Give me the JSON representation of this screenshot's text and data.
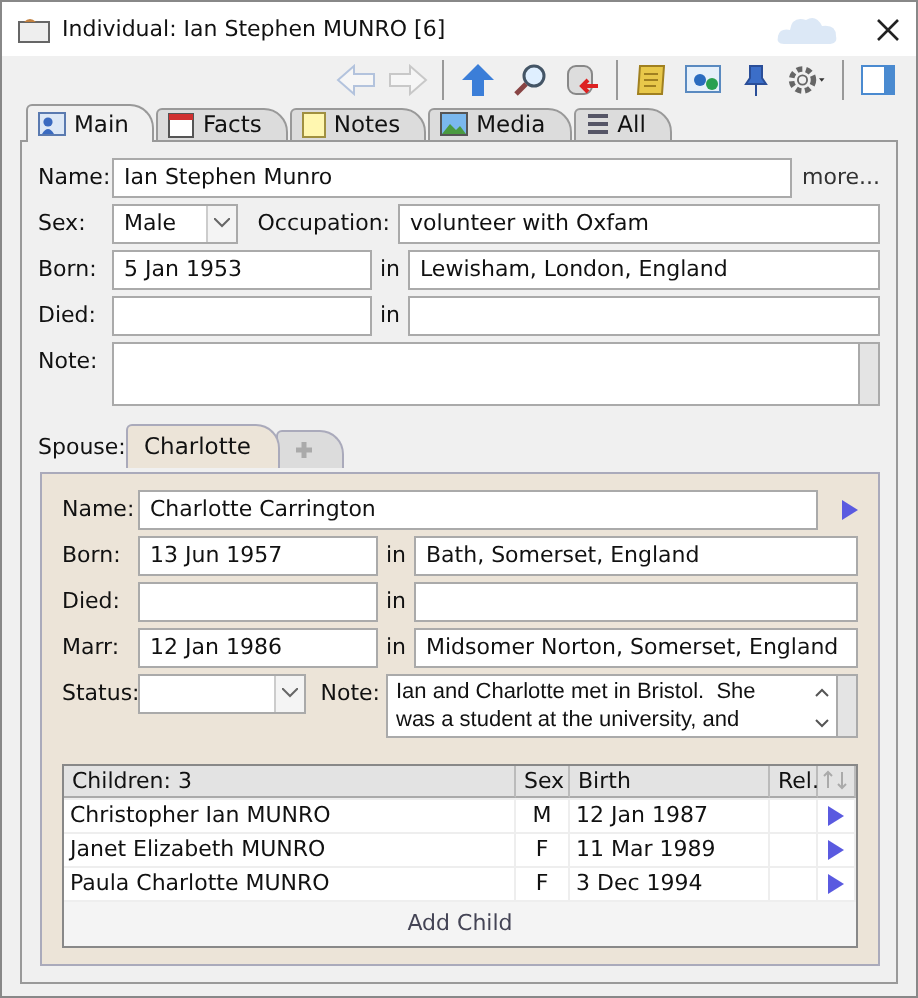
{
  "window": {
    "title": "Individual: Ian Stephen MUNRO [6]"
  },
  "toolbar": [
    {
      "kind": "back",
      "disabled": true
    },
    {
      "kind": "forward",
      "disabled": true
    },
    {
      "kind": "up",
      "disabled": false
    },
    {
      "kind": "search",
      "disabled": false
    },
    {
      "kind": "database",
      "disabled": false
    },
    {
      "kind": "scroll",
      "disabled": false
    },
    {
      "kind": "card",
      "disabled": false
    },
    {
      "kind": "pin",
      "disabled": false
    },
    {
      "kind": "gear",
      "disabled": false
    },
    {
      "kind": "panel",
      "disabled": false
    }
  ],
  "tabs": [
    {
      "label": "Main",
      "kind": "person",
      "selected": true
    },
    {
      "label": "Facts",
      "kind": "calendar",
      "selected": false
    },
    {
      "label": "Notes",
      "kind": "note",
      "selected": false
    },
    {
      "label": "Media",
      "kind": "image",
      "selected": false
    },
    {
      "label": "All",
      "kind": "list",
      "selected": false
    }
  ],
  "person": {
    "name": {
      "label": "Name:",
      "value": "Ian Stephen Munro",
      "more": "more..."
    },
    "sex": {
      "label": "Sex:",
      "value": "Male"
    },
    "occupation": {
      "label": "Occupation:",
      "value": "volunteer with Oxfam"
    },
    "born": {
      "label": "Born:",
      "value": "5 Jan 1953",
      "place_label": "in",
      "place": "Lewisham, London, England"
    },
    "died": {
      "label": "Died:",
      "place_label": "in"
    },
    "note": {
      "label": "Note:"
    }
  },
  "spouse": {
    "label": "Spouse:",
    "tabs": [
      {
        "kind": "name",
        "label": "Charlotte",
        "selected": true
      },
      {
        "kind": "add",
        "selected": false
      }
    ],
    "name": {
      "label": "Name:",
      "value": "Charlotte Carrington"
    },
    "born": {
      "label": "Born:",
      "value": "13 Jun 1957",
      "place_label": "in",
      "place": "Bath, Somerset, England"
    },
    "died": {
      "label": "Died:",
      "place_label": "in"
    },
    "marr": {
      "label": "Marr:",
      "value": "12 Jan 1986",
      "place_label": "in",
      "place": "Midsomer Norton, Somerset, England"
    },
    "status": {
      "label": "Status:"
    },
    "note": {
      "label": "Note:",
      "lines": [
        "Ian and Charlotte met in Bristol.  She",
        "was a student at the university, and"
      ]
    }
  },
  "children": {
    "columns": [
      "Children: 3",
      "Sex",
      "Birth",
      "Rel."
    ],
    "rows": [
      {
        "name": "Christopher Ian MUNRO",
        "sex": "M",
        "birth": "12 Jan 1987"
      },
      {
        "name": "Janet Elizabeth MUNRO",
        "sex": "F",
        "birth": "11 Mar 1989"
      },
      {
        "name": "Paula Charlotte MUNRO",
        "sex": "F",
        "birth": "3 Dec 1994"
      }
    ],
    "add": "Add Child"
  }
}
